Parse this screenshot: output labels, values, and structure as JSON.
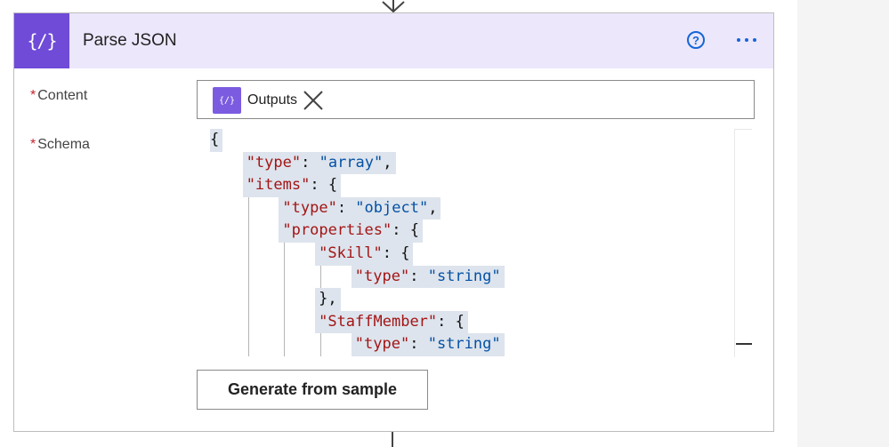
{
  "action": {
    "title": "Parse JSON",
    "icon": "braces-icon",
    "header_color": "#ece7fb",
    "icon_color": "#6f4bd8"
  },
  "header_icons": {
    "help_glyph": "?",
    "help": "help-circle-icon",
    "more": "ellipsis-icon"
  },
  "fields": {
    "required_marker": "*",
    "content": {
      "label": "Content",
      "token": {
        "label": "Outputs",
        "icon": "braces-icon",
        "remove_icon": "close-icon"
      }
    },
    "schema": {
      "label": "Schema",
      "lines": [
        {
          "depth": 0,
          "parts": [
            {
              "t": "p",
              "v": "{"
            }
          ]
        },
        {
          "depth": 1,
          "parts": [
            {
              "t": "k",
              "v": "\"type\""
            },
            {
              "t": "p",
              "v": ": "
            },
            {
              "t": "s",
              "v": "\"array\""
            },
            {
              "t": "p",
              "v": ","
            }
          ]
        },
        {
          "depth": 1,
          "parts": [
            {
              "t": "k",
              "v": "\"items\""
            },
            {
              "t": "p",
              "v": ": {"
            }
          ]
        },
        {
          "depth": 2,
          "parts": [
            {
              "t": "k",
              "v": "\"type\""
            },
            {
              "t": "p",
              "v": ": "
            },
            {
              "t": "s",
              "v": "\"object\""
            },
            {
              "t": "p",
              "v": ","
            }
          ]
        },
        {
          "depth": 2,
          "parts": [
            {
              "t": "k",
              "v": "\"properties\""
            },
            {
              "t": "p",
              "v": ": {"
            }
          ]
        },
        {
          "depth": 3,
          "parts": [
            {
              "t": "k",
              "v": "\"Skill\""
            },
            {
              "t": "p",
              "v": ": {"
            }
          ]
        },
        {
          "depth": 4,
          "parts": [
            {
              "t": "k",
              "v": "\"type\""
            },
            {
              "t": "p",
              "v": ": "
            },
            {
              "t": "s",
              "v": "\"string\""
            }
          ]
        },
        {
          "depth": 3,
          "parts": [
            {
              "t": "p",
              "v": "},"
            }
          ]
        },
        {
          "depth": 3,
          "parts": [
            {
              "t": "k",
              "v": "\"StaffMember\""
            },
            {
              "t": "p",
              "v": ": {"
            }
          ]
        },
        {
          "depth": 4,
          "parts": [
            {
              "t": "k",
              "v": "\"type\""
            },
            {
              "t": "p",
              "v": ": "
            },
            {
              "t": "s",
              "v": "\"string\""
            }
          ]
        }
      ]
    }
  },
  "buttons": {
    "generate_label": "Generate from sample"
  }
}
